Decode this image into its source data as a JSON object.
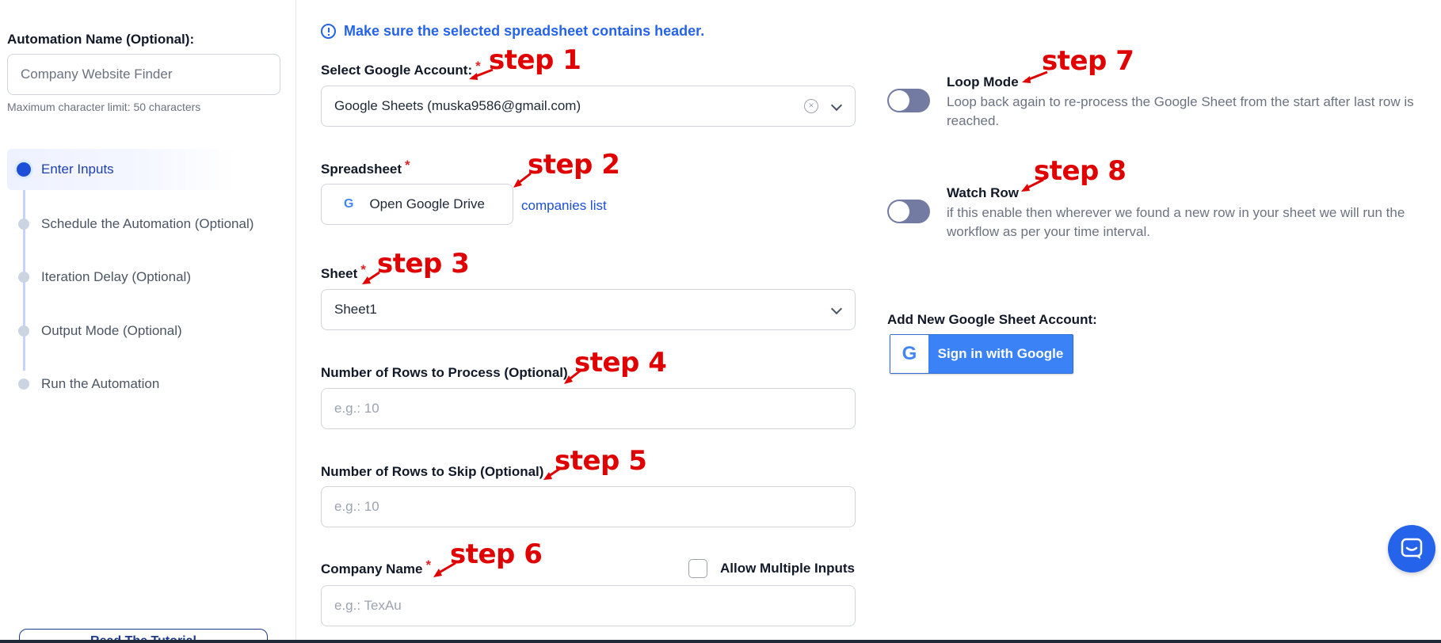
{
  "sidebar": {
    "automation_name_label": "Automation Name (Optional):",
    "automation_name_placeholder": "Company Website Finder",
    "char_limit": "Maximum character limit: 50 characters",
    "steps": [
      {
        "label": "Enter Inputs",
        "active": true
      },
      {
        "label": "Schedule the Automation (Optional)",
        "active": false
      },
      {
        "label": "Iteration Delay (Optional)",
        "active": false
      },
      {
        "label": "Output Mode (Optional)",
        "active": false
      },
      {
        "label": "Run the Automation",
        "active": false
      }
    ],
    "tutorial_button": "Read The Tutorial"
  },
  "main": {
    "info_text": "Make sure the selected spreadsheet contains header.",
    "google_account": {
      "label": "Select Google Account:",
      "required": "*",
      "value": "Google Sheets (muska9586@gmail.com)"
    },
    "spreadsheet": {
      "label": "Spreadsheet",
      "required": "*",
      "button": "Open Google Drive",
      "link": "companies list"
    },
    "sheet": {
      "label": "Sheet",
      "required": "*",
      "value": "Sheet1"
    },
    "rows_to_process": {
      "label": "Number of Rows to Process (Optional)",
      "placeholder": "e.g.: 10"
    },
    "rows_to_skip": {
      "label": "Number of Rows to Skip (Optional)",
      "placeholder": "e.g.: 10"
    },
    "company_name": {
      "label": "Company Name",
      "required": "*",
      "checkbox_label": "Allow Multiple Inputs",
      "placeholder": "e.g.: TexAu"
    }
  },
  "right": {
    "loop_mode": {
      "title": "Loop Mode",
      "description": "Loop back again to re-process the Google Sheet from the start after last row is reached."
    },
    "watch_row": {
      "title": "Watch Row",
      "description": "if this enable then wherever we found a new row in your sheet we will run the workflow as per your time interval."
    },
    "add_account_label": "Add New Google Sheet Account:",
    "google_signin": "Sign in with Google",
    "google_g": "G"
  },
  "annotations": {
    "step1": "step 1",
    "step2": "step 2",
    "step3": "step 3",
    "step4": "step 4",
    "step5": "step 5",
    "step6": "step 6",
    "step7": "step 7",
    "step8": "step 8",
    "color": "#e00000"
  },
  "colors": {
    "accent": "#2563eb",
    "active_step": "#1d4ed8",
    "toggle_off": "#737ba3"
  }
}
